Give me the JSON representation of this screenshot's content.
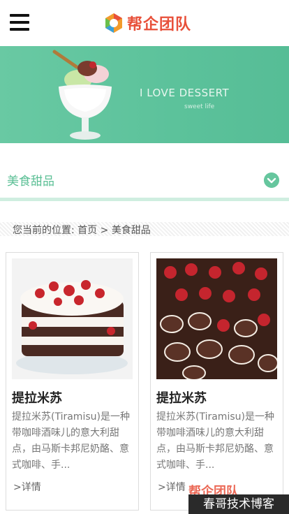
{
  "header": {
    "logo_text": "帮企团队",
    "menu_icon": "hamburger-menu-icon"
  },
  "banner": {
    "title": "I LOVE DESSERT",
    "subtitle": "sweet life"
  },
  "category": {
    "title": "美食甜品",
    "toggle_icon": "chevron-down-circle-icon"
  },
  "breadcrumb": {
    "prefix": "您当前的位置: ",
    "home": "首页",
    "separator": " > ",
    "current": "美食甜品"
  },
  "products": [
    {
      "name": "提拉米苏",
      "desc": "提拉米苏(Tiramisu)是一种带咖啡酒味儿的意大利甜点，由马斯卡邦尼奶酪、意式咖啡、手...",
      "more": ">详情"
    },
    {
      "name": "提拉米苏",
      "desc": "提拉米苏(Tiramisu)是一种带咖啡酒味儿的意大利甜点，由马斯卡邦尼奶酪、意式咖啡、手...",
      "more": ">详情"
    }
  ],
  "watermark": {
    "text": "春哥技术博客",
    "logo_text": "帮企团队"
  },
  "colors": {
    "accent": "#5bbf95",
    "logo": "#e8503a"
  }
}
